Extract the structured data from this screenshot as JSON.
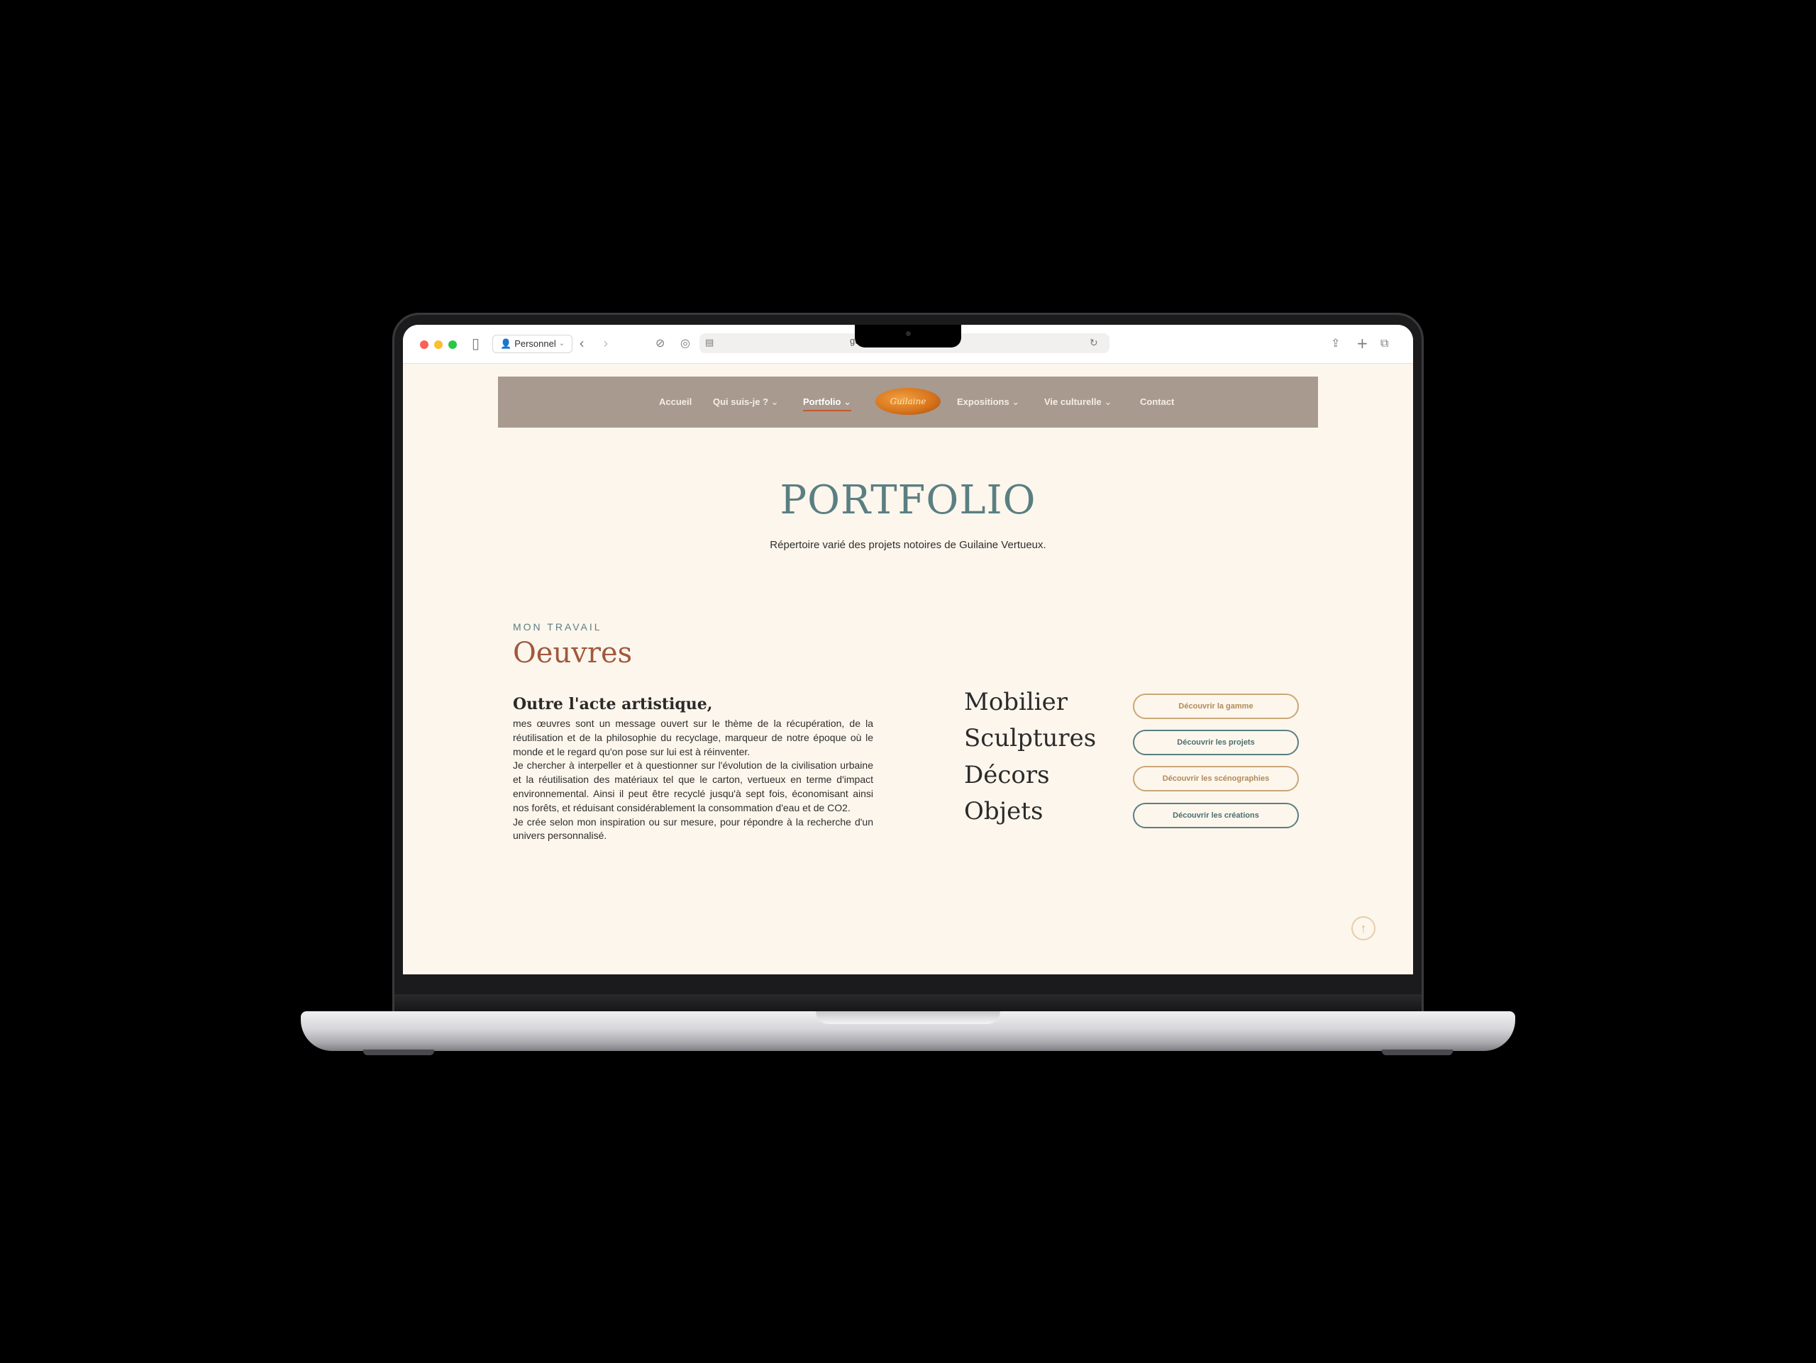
{
  "browser": {
    "profile_label": "Personnel",
    "url": "guilainevertueux",
    "traffic_colors": [
      "#fe5f57",
      "#febc2e",
      "#28c840"
    ]
  },
  "nav": {
    "items": [
      {
        "label": "Accueil"
      },
      {
        "label": "Qui suis-je ?",
        "dropdown": true
      },
      {
        "label": "Portfolio",
        "dropdown": true,
        "active": true
      },
      {
        "label": "Expositions",
        "dropdown": true
      },
      {
        "label": "Vie culturelle",
        "dropdown": true
      },
      {
        "label": "Contact"
      }
    ],
    "logo_text": "Guilaine",
    "background": "#a89a8f"
  },
  "header": {
    "title": "PORTFOLIO",
    "subtitle": "Répertoire varié des projets notoires de Guilaine Vertueux."
  },
  "section": {
    "eyebrow": "MON TRAVAIL",
    "heading": "Oeuvres",
    "lead": "Outre l'acte artistique,",
    "paragraphs": [
      "mes œuvres sont un message ouvert sur le thème de la récupération, de la réutilisation et de la philosophie du recyclage, marqueur de notre époque où le monde et le regard qu'on pose sur lui est à réinventer.",
      "Je chercher à interpeller et à questionner sur l'évolution de la civilisation urbaine et la réutilisation des matériaux tel que le carton, vertueux en terme d'impact environnemental. Ainsi il peut être recyclé jusqu'à sept fois, économisant ainsi nos forêts, et réduisant considérablement la consommation d'eau et de CO2.",
      "Je crée selon mon inspiration ou sur mesure, pour répondre à la recherche d'un univers personnalisé."
    ]
  },
  "categories": [
    {
      "name": "Mobilier",
      "button": "Découvrir la gamme",
      "style": "gold"
    },
    {
      "name": "Sculptures",
      "button": "Découvrir les projets",
      "style": "teal"
    },
    {
      "name": "Décors",
      "button": "Découvrir les scénographies",
      "style": "gold"
    },
    {
      "name": "Objets",
      "button": "Découvrir les créations",
      "style": "teal"
    }
  ],
  "colors": {
    "page_bg": "#fdf6ec",
    "teal": "#5a7f82",
    "terracotta": "#a0593f",
    "gold": "#c8a878"
  }
}
